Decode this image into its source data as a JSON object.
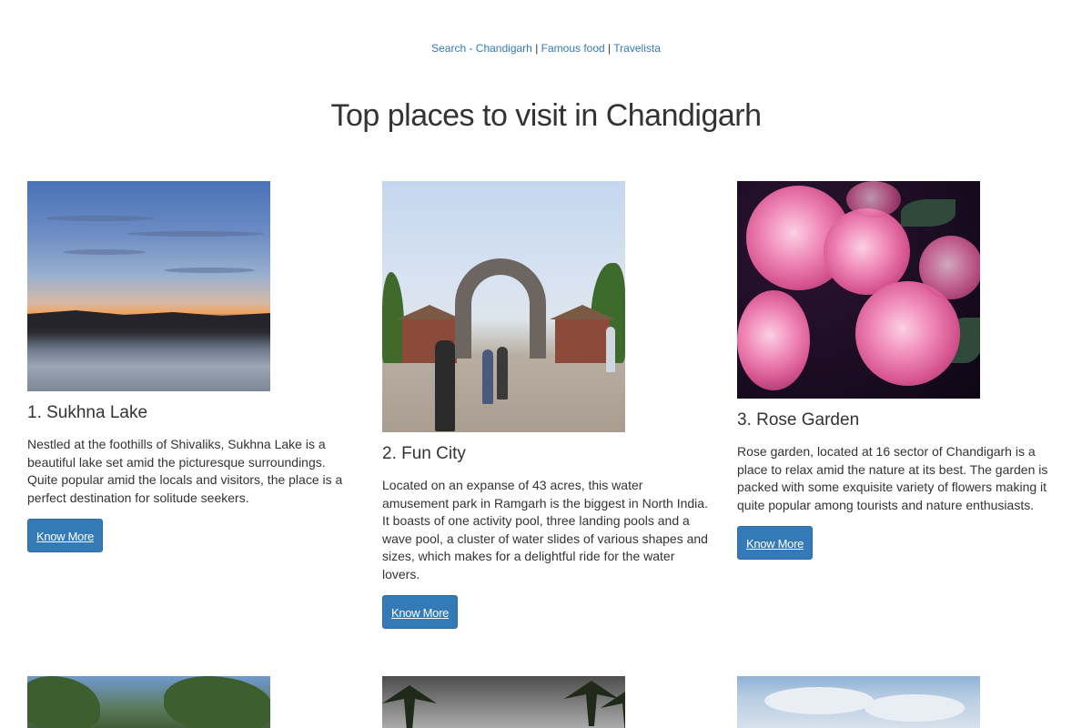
{
  "nav": {
    "links": [
      "Search - Chandigarh",
      "Famous food",
      "Travelista"
    ],
    "separator": "|"
  },
  "page_title": "Top places to visit in Chandigarh",
  "places": [
    {
      "title": "1. Sukhna Lake",
      "description": "Nestled at the foothills of Shivaliks, Sukhna Lake is a beautiful lake set amid the picturesque surroundings. Quite popular amid the locals and visitors, the place is a perfect destination for solitude seekers.",
      "button": "Know More"
    },
    {
      "title": "2. Fun City",
      "description": "Located on an expanse of 43 acres, this water amusement park in Ramgarh is the biggest in North India. It boasts of one activity pool, three landing pools and a wave pool, a cluster of water slides of various shapes and sizes, which makes for a delightful ride for the water lovers.",
      "button": "Know More"
    },
    {
      "title": "3. Rose Garden",
      "description": "Rose garden, located at 16 sector of Chandigarh is a place to relax amid the nature at its best. The garden is packed with some exquisite variety of flowers making it quite popular among tourists and nature enthusiasts.",
      "button": "Know More"
    }
  ],
  "colors": {
    "link": "#337ab7",
    "button_bg": "#337ab7",
    "button_text": "#ffffff",
    "text": "#333333"
  }
}
